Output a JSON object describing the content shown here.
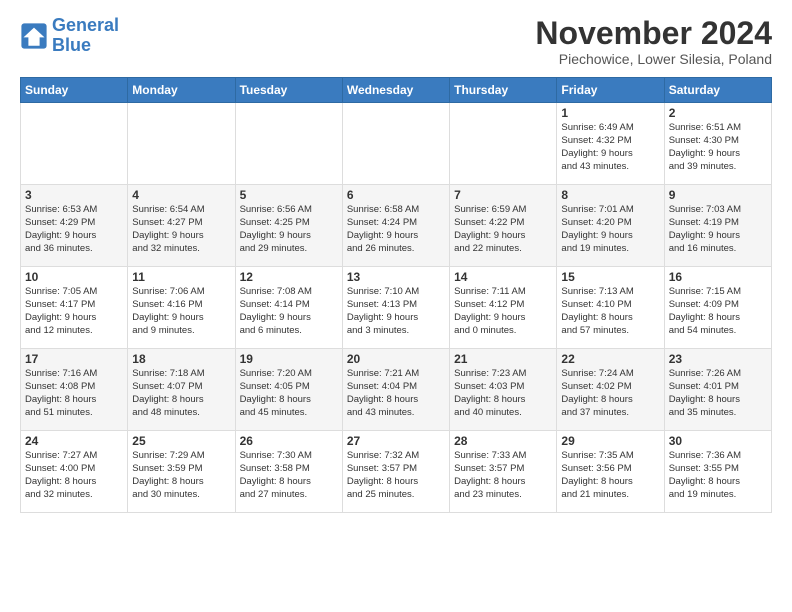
{
  "logo": {
    "line1": "General",
    "line2": "Blue"
  },
  "title": "November 2024",
  "location": "Piechowice, Lower Silesia, Poland",
  "headers": [
    "Sunday",
    "Monday",
    "Tuesday",
    "Wednesday",
    "Thursday",
    "Friday",
    "Saturday"
  ],
  "weeks": [
    [
      {
        "day": "",
        "info": ""
      },
      {
        "day": "",
        "info": ""
      },
      {
        "day": "",
        "info": ""
      },
      {
        "day": "",
        "info": ""
      },
      {
        "day": "",
        "info": ""
      },
      {
        "day": "1",
        "info": "Sunrise: 6:49 AM\nSunset: 4:32 PM\nDaylight: 9 hours\nand 43 minutes."
      },
      {
        "day": "2",
        "info": "Sunrise: 6:51 AM\nSunset: 4:30 PM\nDaylight: 9 hours\nand 39 minutes."
      }
    ],
    [
      {
        "day": "3",
        "info": "Sunrise: 6:53 AM\nSunset: 4:29 PM\nDaylight: 9 hours\nand 36 minutes."
      },
      {
        "day": "4",
        "info": "Sunrise: 6:54 AM\nSunset: 4:27 PM\nDaylight: 9 hours\nand 32 minutes."
      },
      {
        "day": "5",
        "info": "Sunrise: 6:56 AM\nSunset: 4:25 PM\nDaylight: 9 hours\nand 29 minutes."
      },
      {
        "day": "6",
        "info": "Sunrise: 6:58 AM\nSunset: 4:24 PM\nDaylight: 9 hours\nand 26 minutes."
      },
      {
        "day": "7",
        "info": "Sunrise: 6:59 AM\nSunset: 4:22 PM\nDaylight: 9 hours\nand 22 minutes."
      },
      {
        "day": "8",
        "info": "Sunrise: 7:01 AM\nSunset: 4:20 PM\nDaylight: 9 hours\nand 19 minutes."
      },
      {
        "day": "9",
        "info": "Sunrise: 7:03 AM\nSunset: 4:19 PM\nDaylight: 9 hours\nand 16 minutes."
      }
    ],
    [
      {
        "day": "10",
        "info": "Sunrise: 7:05 AM\nSunset: 4:17 PM\nDaylight: 9 hours\nand 12 minutes."
      },
      {
        "day": "11",
        "info": "Sunrise: 7:06 AM\nSunset: 4:16 PM\nDaylight: 9 hours\nand 9 minutes."
      },
      {
        "day": "12",
        "info": "Sunrise: 7:08 AM\nSunset: 4:14 PM\nDaylight: 9 hours\nand 6 minutes."
      },
      {
        "day": "13",
        "info": "Sunrise: 7:10 AM\nSunset: 4:13 PM\nDaylight: 9 hours\nand 3 minutes."
      },
      {
        "day": "14",
        "info": "Sunrise: 7:11 AM\nSunset: 4:12 PM\nDaylight: 9 hours\nand 0 minutes."
      },
      {
        "day": "15",
        "info": "Sunrise: 7:13 AM\nSunset: 4:10 PM\nDaylight: 8 hours\nand 57 minutes."
      },
      {
        "day": "16",
        "info": "Sunrise: 7:15 AM\nSunset: 4:09 PM\nDaylight: 8 hours\nand 54 minutes."
      }
    ],
    [
      {
        "day": "17",
        "info": "Sunrise: 7:16 AM\nSunset: 4:08 PM\nDaylight: 8 hours\nand 51 minutes."
      },
      {
        "day": "18",
        "info": "Sunrise: 7:18 AM\nSunset: 4:07 PM\nDaylight: 8 hours\nand 48 minutes."
      },
      {
        "day": "19",
        "info": "Sunrise: 7:20 AM\nSunset: 4:05 PM\nDaylight: 8 hours\nand 45 minutes."
      },
      {
        "day": "20",
        "info": "Sunrise: 7:21 AM\nSunset: 4:04 PM\nDaylight: 8 hours\nand 43 minutes."
      },
      {
        "day": "21",
        "info": "Sunrise: 7:23 AM\nSunset: 4:03 PM\nDaylight: 8 hours\nand 40 minutes."
      },
      {
        "day": "22",
        "info": "Sunrise: 7:24 AM\nSunset: 4:02 PM\nDaylight: 8 hours\nand 37 minutes."
      },
      {
        "day": "23",
        "info": "Sunrise: 7:26 AM\nSunset: 4:01 PM\nDaylight: 8 hours\nand 35 minutes."
      }
    ],
    [
      {
        "day": "24",
        "info": "Sunrise: 7:27 AM\nSunset: 4:00 PM\nDaylight: 8 hours\nand 32 minutes."
      },
      {
        "day": "25",
        "info": "Sunrise: 7:29 AM\nSunset: 3:59 PM\nDaylight: 8 hours\nand 30 minutes."
      },
      {
        "day": "26",
        "info": "Sunrise: 7:30 AM\nSunset: 3:58 PM\nDaylight: 8 hours\nand 27 minutes."
      },
      {
        "day": "27",
        "info": "Sunrise: 7:32 AM\nSunset: 3:57 PM\nDaylight: 8 hours\nand 25 minutes."
      },
      {
        "day": "28",
        "info": "Sunrise: 7:33 AM\nSunset: 3:57 PM\nDaylight: 8 hours\nand 23 minutes."
      },
      {
        "day": "29",
        "info": "Sunrise: 7:35 AM\nSunset: 3:56 PM\nDaylight: 8 hours\nand 21 minutes."
      },
      {
        "day": "30",
        "info": "Sunrise: 7:36 AM\nSunset: 3:55 PM\nDaylight: 8 hours\nand 19 minutes."
      }
    ]
  ]
}
